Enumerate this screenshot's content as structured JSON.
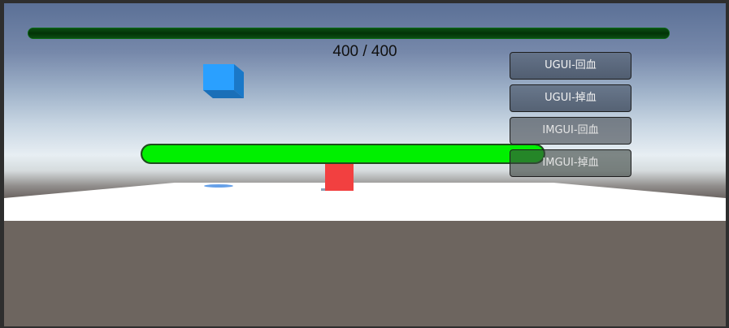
{
  "hud": {
    "health_text": "400 / 400",
    "top_bar_fill_fraction": 1.0,
    "world_bar_fill_fraction": 1.0,
    "top_bar_color": "#023306",
    "world_bar_color": "#00f000"
  },
  "buttons": [
    {
      "label": "UGUI-回血",
      "kind": "ugui"
    },
    {
      "label": "UGUI-掉血",
      "kind": "ugui"
    },
    {
      "label": "IMGUI-回血",
      "kind": "imgui"
    },
    {
      "label": "IMGUI-掉血",
      "kind": "imgui"
    }
  ],
  "scene": {
    "cube_color": "#2b9bff",
    "enemy_color": "#f24040",
    "ground_color": "#ffffff"
  }
}
